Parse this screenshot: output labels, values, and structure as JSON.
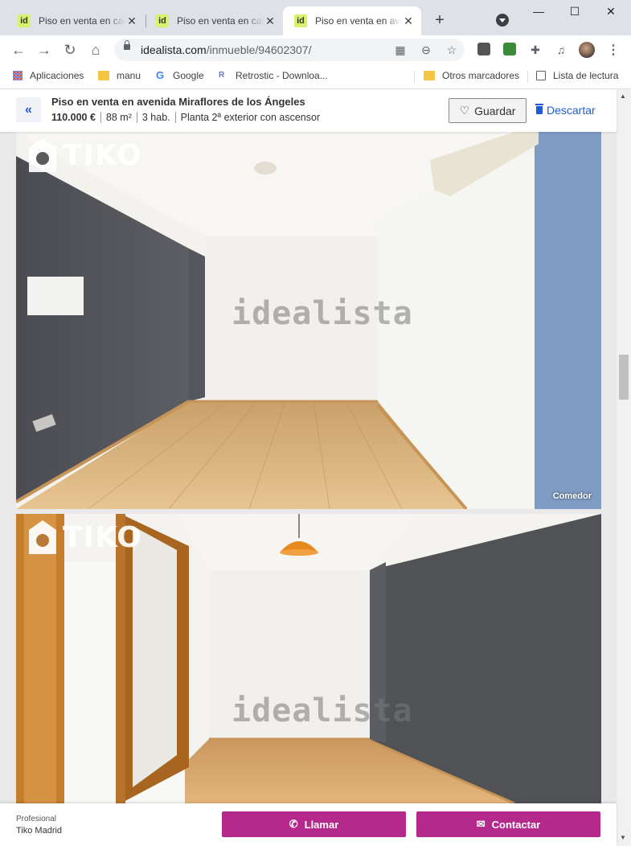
{
  "browser": {
    "tabs": [
      {
        "favicon": "id",
        "title": "Piso en venta en calle"
      },
      {
        "favicon": "id",
        "title": "Piso en venta en calle"
      },
      {
        "favicon": "id",
        "title": "Piso en venta en avenida"
      }
    ],
    "active_tab": 2,
    "url_domain": "idealista.com",
    "url_path": "/inmueble/94602307/"
  },
  "bookmarks": {
    "apps": "Aplicaciones",
    "items": [
      "manu",
      "Google",
      "Retrostic - Downloa..."
    ],
    "others": "Otros marcadores",
    "reading_list": "Lista de lectura"
  },
  "listing": {
    "title": "Piso en venta en avenida Miraflores de los Ángeles",
    "price": "110.000 €",
    "area": "88 m²",
    "rooms": "3 hab.",
    "floor": "Planta 2ª exterior con ascensor",
    "save_label": "Guardar",
    "discard_label": "Descartar"
  },
  "photos": [
    {
      "watermark": "idealista",
      "brand": "TIKO",
      "caption": "Comedor"
    },
    {
      "watermark": "idealista",
      "brand": "TIKO",
      "caption": ""
    }
  ],
  "contact": {
    "type_label": "Profesional",
    "name": "Tiko Madrid",
    "call_label": "Llamar",
    "contact_label": "Contactar"
  },
  "colors": {
    "accent": "#b5298c",
    "link": "#1e5bd6",
    "idealista_favicon": "#d8f26d"
  }
}
